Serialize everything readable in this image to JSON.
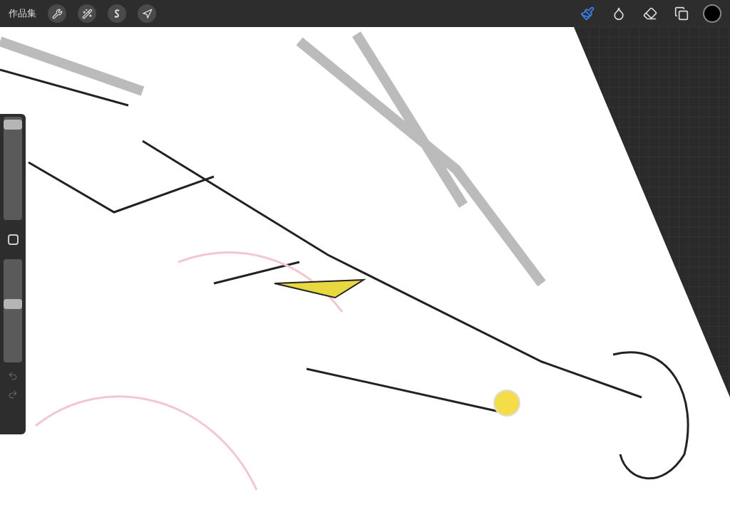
{
  "toolbar": {
    "gallery_label": "作品集",
    "tools": [
      {
        "kind": "brush",
        "selected": true
      },
      {
        "kind": "smudge",
        "selected": false
      },
      {
        "kind": "eraser",
        "selected": false
      }
    ]
  },
  "sidebar": {
    "size_slider": {
      "level": 0.97
    },
    "opacity_slider": {
      "level": 0.57
    }
  }
}
